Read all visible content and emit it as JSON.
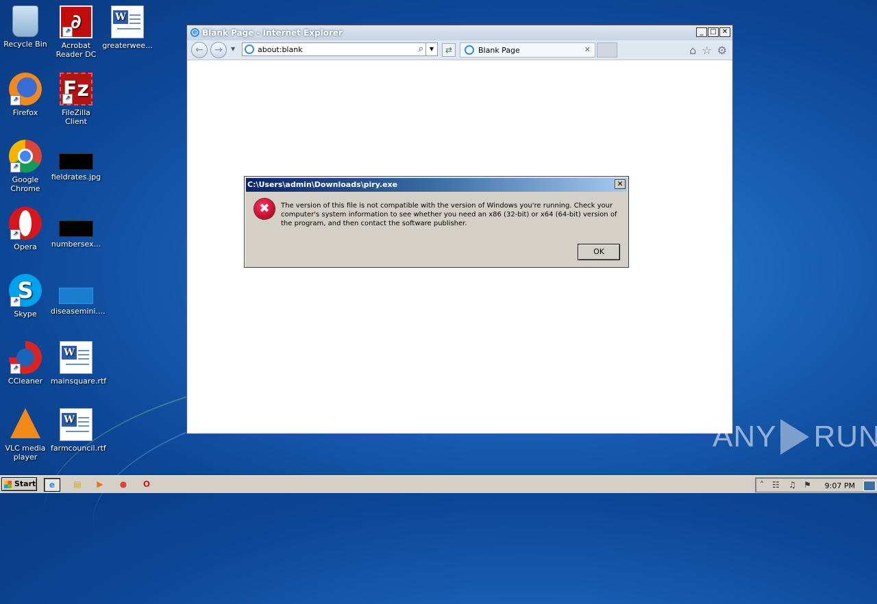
{
  "desktop": {
    "icons": [
      {
        "label": "Recycle Bin"
      },
      {
        "label": "Acrobat Reader DC"
      },
      {
        "label": "greaterwee..."
      },
      {
        "label": "Firefox"
      },
      {
        "label": "FileZilla Client"
      },
      {
        "label": "Google Chrome"
      },
      {
        "label": "fieldrates.jpg"
      },
      {
        "label": "Opera"
      },
      {
        "label": "numbersex..."
      },
      {
        "label": "Skype"
      },
      {
        "label": "diseasemini...."
      },
      {
        "label": "CCleaner"
      },
      {
        "label": "mainsquare.rtf"
      },
      {
        "label": "VLC media player"
      },
      {
        "label": "farmcouncil.rtf"
      }
    ]
  },
  "ie": {
    "title": "Blank Page - Internet Explorer",
    "address": "about:blank",
    "tab_label": "Blank Page"
  },
  "dialog": {
    "title": "C:\\Users\\admin\\Downloads\\piry.exe",
    "message": "The version of this file is not compatible with the version of Windows you're running. Check your computer's system information to see whether you need an x86 (32-bit) or x64 (64-bit) version of the program, and then contact the software publisher.",
    "ok_label": "OK"
  },
  "watermark": {
    "left": "ANY",
    "right": "RUN"
  },
  "taskbar": {
    "start_label": "Start",
    "clock": "9:07 PM"
  },
  "colors": {
    "dialog_title_start": "#0a246a",
    "dialog_title_end": "#a6caf0",
    "error_red": "#c8102e",
    "desktop_blue": "#1a63b8"
  }
}
